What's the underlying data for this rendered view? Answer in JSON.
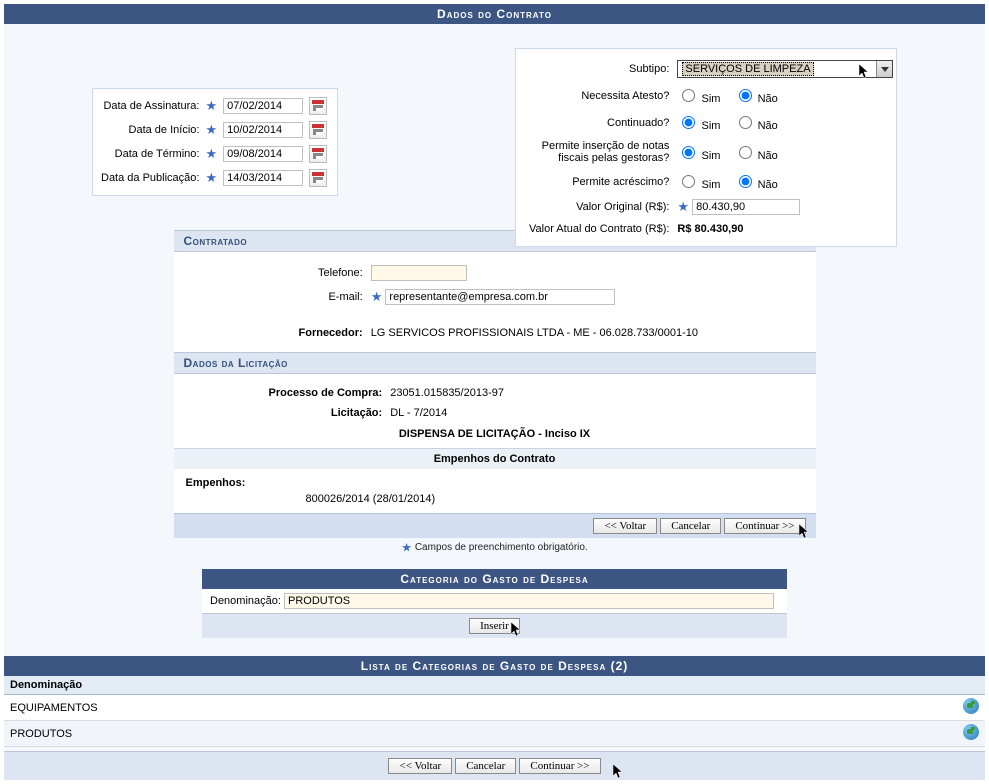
{
  "headers": {
    "main": "Dados do Contrato",
    "contratado": "Contratado",
    "licitacao": "Dados da Licitação",
    "empenhos": "Empenhos do Contrato",
    "categoria": "Categoria do Gasto de Despesa",
    "lista": "Lista de Categorias de Gasto de Despesa (2)"
  },
  "dates": {
    "assinatura_label": "Data de Assinatura:",
    "assinatura": "07/02/2014",
    "inicio_label": "Data de Início:",
    "inicio": "10/02/2014",
    "termino_label": "Data de Término:",
    "termino": "09/08/2014",
    "publicacao_label": "Data da Publicação:",
    "publicacao": "14/03/2014"
  },
  "right": {
    "subtipo_label": "Subtipo:",
    "subtipo_value": "SERVIÇOS DE LIMPEZA",
    "atesto_label": "Necessita Atesto?",
    "continuado_label": "Continuado?",
    "notas_label": "Permite inserção de notas fiscais pelas gestoras?",
    "acrescimo_label": "Permite acréscimo?",
    "sim": "Sim",
    "nao": "Não",
    "valor_original_label": "Valor Original (R$):",
    "valor_original": "80.430,90",
    "valor_atual_label": "Valor Atual do Contrato (R$):",
    "valor_atual": "R$ 80.430,90"
  },
  "contratado": {
    "telefone_label": "Telefone:",
    "telefone": "",
    "email_label": "E-mail:",
    "email": "representante@empresa.com.br",
    "fornecedor_label": "Fornecedor:",
    "fornecedor": "LG SERVICOS PROFISSIONAIS LTDA - ME - 06.028.733/0001-10"
  },
  "licitacao": {
    "processo_label": "Processo de Compra:",
    "processo": "23051.015835/2013-97",
    "licit_label": "Licitação:",
    "licit": "DL - 7/2014",
    "detalhe": "DISPENSA DE LICITAÇÃO - Inciso IX"
  },
  "empenhos": {
    "label": "Empenhos:",
    "valor": "800026/2014 (28/01/2014)"
  },
  "buttons": {
    "voltar": "<< Voltar",
    "cancelar": "Cancelar",
    "continuar": "Continuar >>",
    "inserir": "Inserir"
  },
  "hint": "Campos de preenchimento obrigatório.",
  "categoria": {
    "denom_label": "Denominação:",
    "denom": "PRODUTOS"
  },
  "lista": {
    "col_denom": "Denominação",
    "rows": [
      "EQUIPAMENTOS",
      "PRODUTOS"
    ]
  }
}
